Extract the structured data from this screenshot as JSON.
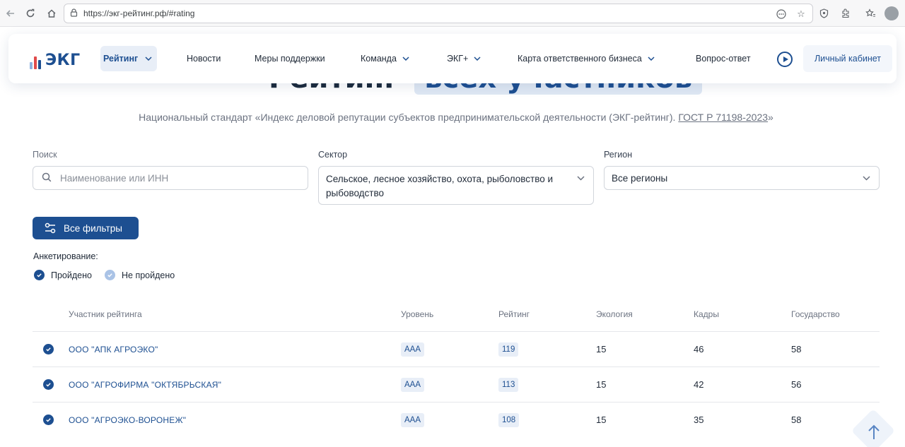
{
  "browser": {
    "url": "https://экг-рейтинг.рф/#rating"
  },
  "header": {
    "logo_text": "ЭКГ",
    "nav": [
      {
        "label": "Рейтинг",
        "active": true,
        "has_dropdown": true
      },
      {
        "label": "Новости",
        "has_dropdown": false
      },
      {
        "label": "Меры поддержки",
        "has_dropdown": false
      },
      {
        "label": "Команда",
        "has_dropdown": true
      },
      {
        "label": "ЭКГ+",
        "has_dropdown": true
      },
      {
        "label": "Карта ответственного бизнеса",
        "has_dropdown": true
      },
      {
        "label": "Вопрос-ответ",
        "has_dropdown": false
      }
    ],
    "cabinet_label": "Личный кабинет"
  },
  "page": {
    "heading_part1": "Рейтинг",
    "heading_part2": "всех участников",
    "subtitle_text": "Национальный стандарт «Индекс деловой репутации субъектов предпринимательской деятельности (ЭКГ-рейтинг).",
    "subtitle_link": "ГОСТ Р 71198-2023",
    "subtitle_end": "»"
  },
  "filters": {
    "search_label": "Поиск",
    "search_placeholder": "Наименование или ИНН",
    "sector_label": "Сектор",
    "sector_value": "Сельское, лесное хозяйство, охота, рыболовство и рыбоводство",
    "region_label": "Регион",
    "region_value": "Все регионы",
    "all_filters_label": "Все фильтры",
    "survey_label": "Анкетирование:",
    "survey_options": [
      {
        "label": "Пройдено",
        "checked": true
      },
      {
        "label": "Не пройдено",
        "checked": true
      }
    ]
  },
  "table": {
    "columns": [
      "Участник рейтинга",
      "Уровень",
      "Рейтинг",
      "Экология",
      "Кадры",
      "Государство"
    ],
    "rows": [
      {
        "name": "ООО \"АПК АГРОЭКО\"",
        "level": "ААА",
        "rating": "119",
        "ecology": "15",
        "staff": "46",
        "state": "58"
      },
      {
        "name": "ООО \"АГРОФИРМА \"ОКТЯБРЬСКАЯ\"",
        "level": "ААА",
        "rating": "113",
        "ecology": "15",
        "staff": "42",
        "state": "56"
      },
      {
        "name": "ООО \"АГРОЭКО-ВОРОНЕЖ\"",
        "level": "ААА",
        "rating": "108",
        "ecology": "15",
        "staff": "35",
        "state": "58"
      }
    ]
  },
  "colors": {
    "brand": "#1d4f91",
    "accent_light": "#e8eef7",
    "logo_bar_red": "#e04b4b",
    "logo_bar_light": "#8fb2e0"
  }
}
